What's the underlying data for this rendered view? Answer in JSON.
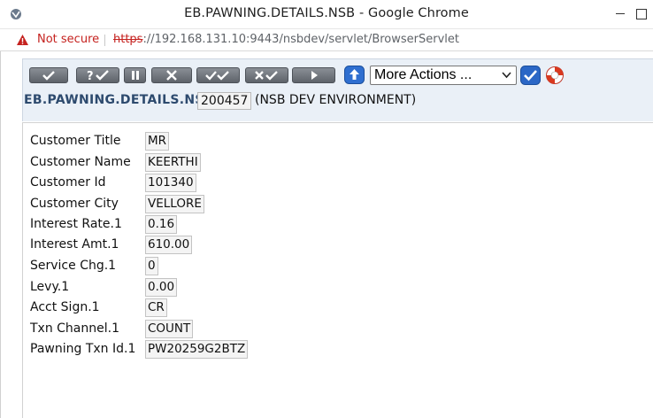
{
  "window": {
    "title": "EB.PAWNING.DETAILS.NSB - Google Chrome"
  },
  "address_bar": {
    "security_label": "Not secure",
    "url_scheme": "https",
    "url_rest": "://192.168.131.10:9443/nsbdev/servlet/BrowserServlet"
  },
  "toolbar": {
    "more_actions_label": "More Actions ...",
    "buttons": [
      "commit-icon",
      "validate-icon",
      "hold-icon",
      "delete-icon",
      "authorise-icon",
      "reverse-icon",
      "next-icon"
    ]
  },
  "header": {
    "app_name": "EB.PAWNING.DETAILS.NSB",
    "record_id": "200457",
    "environment": "(NSB DEV ENVIRONMENT)"
  },
  "fields": [
    {
      "label": "Customer Title",
      "value": "MR"
    },
    {
      "label": "Customer Name",
      "value": "KEERTHI"
    },
    {
      "label": "Customer Id",
      "value": "101340"
    },
    {
      "label": "Customer City",
      "value": "VELLORE"
    },
    {
      "label": "Interest Rate.1",
      "value": "0.16"
    },
    {
      "label": "Interest Amt.1",
      "value": "610.00"
    },
    {
      "label": "Service Chg.1",
      "value": "0"
    },
    {
      "label": "Levy.1",
      "value": "0.00"
    },
    {
      "label": "Acct Sign.1",
      "value": "CR"
    },
    {
      "label": "Txn Channel.1",
      "value": "COUNT"
    },
    {
      "label": "Pawning Txn Id.1",
      "value": "PW20259G2BTZ"
    }
  ],
  "colors": {
    "header_text": "#2d4a6e",
    "toolbar_background": "#eaf0f7",
    "not_secure": "#c5221f"
  }
}
